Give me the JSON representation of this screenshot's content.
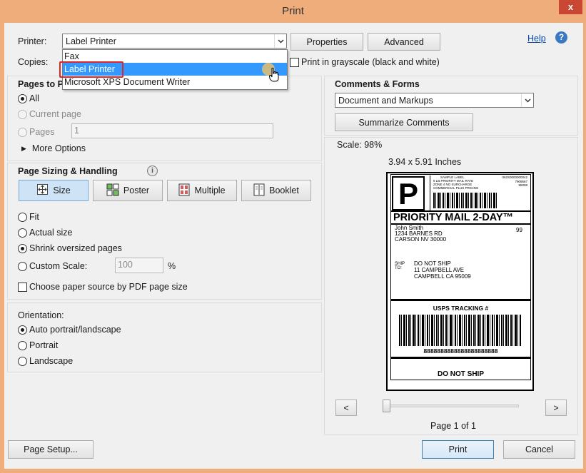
{
  "window": {
    "title": "Print",
    "close_label": "x"
  },
  "printer": {
    "label": "Printer:",
    "selected": "Label Printer",
    "properties_label": "Properties",
    "advanced_label": "Advanced",
    "options": [
      "Fax",
      "Label Printer",
      "Microsoft XPS Document Writer"
    ]
  },
  "copies": {
    "label": "Copies:"
  },
  "grayscale": {
    "label": "Print in grayscale (black and white)",
    "checked": false
  },
  "help": {
    "label": "Help"
  },
  "pages_to_print": {
    "title": "Pages to Pr",
    "all_label": "All",
    "current_label": "Current page",
    "pages_label": "Pages",
    "pages_value": "1",
    "more_options_label": "More Options"
  },
  "sizing": {
    "title": "Page Sizing & Handling",
    "buttons": [
      "Size",
      "Poster",
      "Multiple",
      "Booklet"
    ],
    "active": "Size",
    "fit_label": "Fit",
    "actual_label": "Actual size",
    "shrink_label": "Shrink oversized pages",
    "custom_label": "Custom Scale:",
    "custom_value": "100",
    "percent_label": "%",
    "paper_source_label": "Choose paper source by PDF page size"
  },
  "orientation": {
    "title": "Orientation:",
    "auto_label": "Auto portrait/landscape",
    "portrait_label": "Portrait",
    "landscape_label": "Landscape"
  },
  "comments": {
    "title": "Comments & Forms",
    "selected": "Document and Markups",
    "summarize_label": "Summarize Comments"
  },
  "preview": {
    "scale": "Scale:  98%",
    "size": "3.94 x 5.91 Inches",
    "page_info": "Page 1 of 1",
    "prev_label": "<",
    "next_label": ">"
  },
  "shipping_label": {
    "big_letter": "P",
    "sample_lines": [
      "SAMPLE LABEL",
      "6 LB PRIORITY MAIL RATE",
      "ZONE 4 NO SURCHARGE",
      "COMMERCIAL PLUS PRICING"
    ],
    "code_lines": [
      "062S0000000042",
      "7908567",
      "95008"
    ],
    "service": "PRIORITY MAIL 2-DAY™",
    "from_name": "John Smith",
    "from_street": "1234 BARNES RD",
    "from_city": "CARSON NV 30000",
    "from_code": "99",
    "ship_to_label_1": "SHIP",
    "ship_to_label_2": "TO:",
    "to_name": "DO NOT SHIP",
    "to_street": "11 CAMPBELL AVE",
    "to_city": "CAMPBELL CA 95009",
    "tracking_title": "USPS TRACKING #",
    "tracking_number": "8888888888888888888888",
    "footer": "DO NOT SHIP"
  },
  "buttons": {
    "page_setup": "Page Setup...",
    "print": "Print",
    "cancel": "Cancel"
  },
  "colors": {
    "accent": "#3399ff",
    "highlight_border": "#e0242a",
    "titlebar": "#f0ad7c"
  }
}
